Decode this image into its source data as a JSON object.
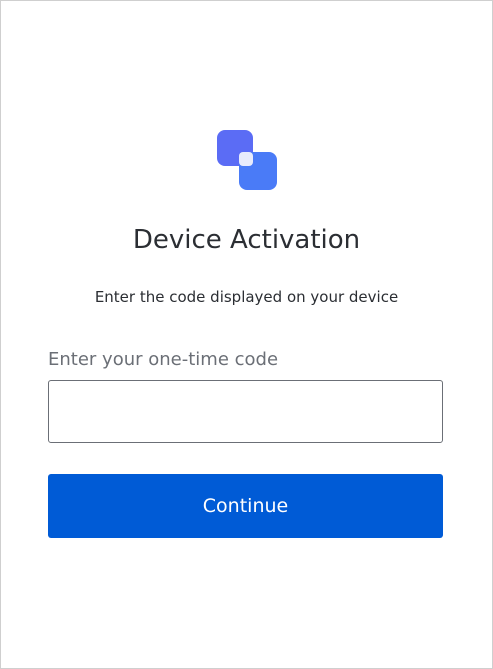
{
  "logo": {
    "icon": "app-logo-icon",
    "colors": {
      "back": "#5b6cf5",
      "front": "#4a7bf7",
      "overlap": "#e8ebfc"
    }
  },
  "title": "Device Activation",
  "subtitle": "Enter the code displayed on your device",
  "code_field": {
    "label": "Enter your one-time code",
    "value": "",
    "placeholder": ""
  },
  "continue_button": {
    "label": "Continue",
    "color": "#005bd6"
  }
}
